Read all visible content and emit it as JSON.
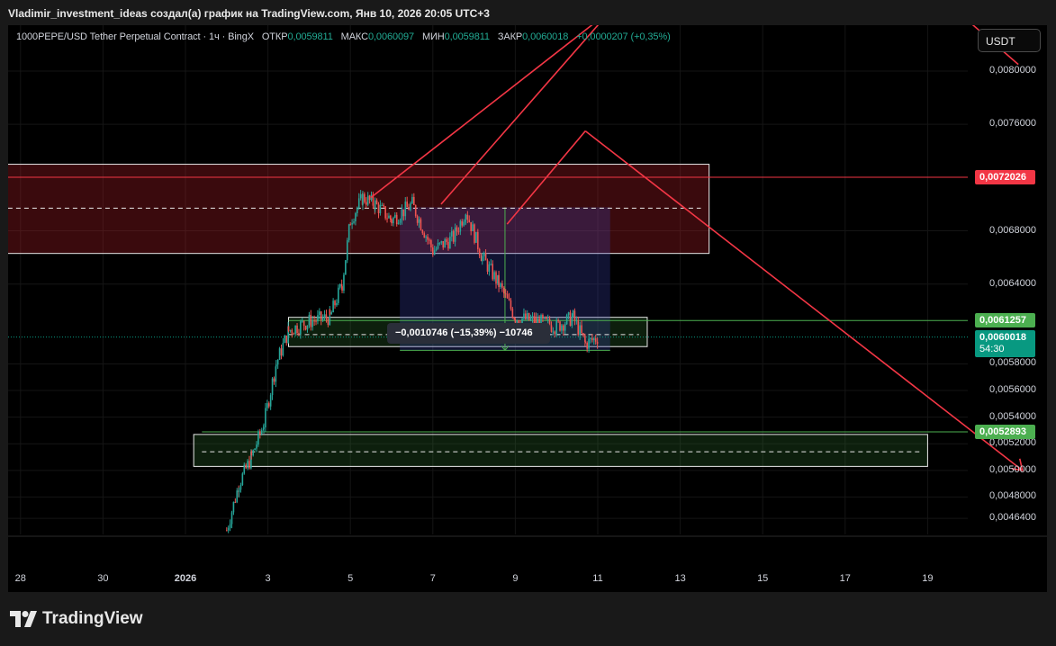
{
  "header": {
    "title": "Vladimir_investment_ideas создал(а) график на TradingView.com, Янв 10, 2026 20:05 UTC+3"
  },
  "legend": {
    "symbol": "1000PEPE/USD Tether Perpetual Contract · 1ч · BingX",
    "open_label": "ОТКР",
    "open_value": "0,0059811",
    "high_label": "МАКС",
    "high_value": "0,0060097",
    "low_label": "МИН",
    "low_value": "0,0059811",
    "close_label": "ЗАКР",
    "close_value": "0,0060018",
    "change": "+0,0000207 (+0,35%)"
  },
  "currency_button": "USDT",
  "price_axis": {
    "ticks": [
      {
        "label": "0,0080000",
        "value": 0.008
      },
      {
        "label": "0,0076000",
        "value": 0.0076
      },
      {
        "label": "0,0068000",
        "value": 0.0068
      },
      {
        "label": "0,0064000",
        "value": 0.0064
      },
      {
        "label": "0,0058000",
        "value": 0.0058
      },
      {
        "label": "0,0056000",
        "value": 0.0056
      },
      {
        "label": "0,0054000",
        "value": 0.0054
      },
      {
        "label": "0,0052000",
        "value": 0.0052
      },
      {
        "label": "0,0050000",
        "value": 0.005
      },
      {
        "label": "0,0048000",
        "value": 0.0048
      },
      {
        "label": "0,0046400",
        "value": 0.00464
      }
    ],
    "badges": {
      "resistance": {
        "label": "0,0072026",
        "value": 0.0072026,
        "color": "#f23645"
      },
      "mid_level": {
        "label": "0,0061257",
        "value": 0.0061257,
        "color": "#4caf50"
      },
      "last_price": {
        "label": "0,0060018",
        "value": 0.0060018,
        "timer": "54:30",
        "color": "#089981"
      },
      "support": {
        "label": "0,0052893",
        "value": 0.0052893,
        "color": "#4caf50"
      }
    }
  },
  "time_axis": {
    "ticks": [
      {
        "label": "28",
        "day": -4
      },
      {
        "label": "30",
        "day": -2
      },
      {
        "label": "2026",
        "day": 0
      },
      {
        "label": "3",
        "day": 2
      },
      {
        "label": "5",
        "day": 4
      },
      {
        "label": "7",
        "day": 6
      },
      {
        "label": "9",
        "day": 8
      },
      {
        "label": "11",
        "day": 10
      },
      {
        "label": "13",
        "day": 12
      },
      {
        "label": "15",
        "day": 14
      },
      {
        "label": "17",
        "day": 16
      },
      {
        "label": "19",
        "day": 18
      }
    ]
  },
  "measure": {
    "text": "−0,0010746 (−15,39%) −10746",
    "from_price": 0.0069765,
    "to_price": 0.0059019
  },
  "chart_data": {
    "type": "candlestick",
    "title": "1000PEPE/USD Tether Perpetual Contract · 1ч · BingX",
    "ylim": [
      0.0045,
      0.0082
    ],
    "xlim_days": [
      -4.5,
      20.3
    ],
    "day_origin": "2026-01-01",
    "candles_summary": [
      {
        "day": 1.0,
        "price": 0.00455
      },
      {
        "day": 1.3,
        "price": 0.0049
      },
      {
        "day": 1.6,
        "price": 0.0051
      },
      {
        "day": 1.9,
        "price": 0.00535
      },
      {
        "day": 2.2,
        "price": 0.0058
      },
      {
        "day": 2.5,
        "price": 0.00605
      },
      {
        "day": 3.0,
        "price": 0.00612
      },
      {
        "day": 3.5,
        "price": 0.00615
      },
      {
        "day": 3.8,
        "price": 0.0064
      },
      {
        "day": 4.0,
        "price": 0.00688
      },
      {
        "day": 4.3,
        "price": 0.00705
      },
      {
        "day": 4.6,
        "price": 0.007
      },
      {
        "day": 5.0,
        "price": 0.00688
      },
      {
        "day": 5.5,
        "price": 0.007
      },
      {
        "day": 6.0,
        "price": 0.00665
      },
      {
        "day": 6.5,
        "price": 0.00675
      },
      {
        "day": 6.8,
        "price": 0.00695
      },
      {
        "day": 7.2,
        "price": 0.0066
      },
      {
        "day": 7.6,
        "price": 0.0064
      },
      {
        "day": 8.0,
        "price": 0.00615
      },
      {
        "day": 8.5,
        "price": 0.00612
      },
      {
        "day": 9.0,
        "price": 0.00608
      },
      {
        "day": 9.4,
        "price": 0.00615
      },
      {
        "day": 9.7,
        "price": 0.00595
      },
      {
        "day": 10.0,
        "price": 0.006
      }
    ],
    "zones": [
      {
        "name": "resistance-zone",
        "day_from": -4.5,
        "day_to": 12.7,
        "price_from": 0.00663,
        "price_to": 0.0073,
        "color": "#f23645"
      },
      {
        "name": "mid-zone",
        "day_from": 2.5,
        "day_to": 11.2,
        "price_from": 0.00593,
        "price_to": 0.00615,
        "color": "#4caf50"
      },
      {
        "name": "support-zone",
        "day_from": 0.2,
        "day_to": 18.0,
        "price_from": 0.00503,
        "price_to": 0.00527,
        "color": "#4caf50"
      }
    ],
    "dashed_levels": [
      {
        "price": 0.00697,
        "day_from": -4.5,
        "day_to": 12.5
      },
      {
        "price": 0.00602,
        "day_from": 2.5,
        "day_to": 11.0
      },
      {
        "price": 0.00514,
        "day_from": 0.4,
        "day_to": 17.8
      }
    ],
    "horizontal_lines": [
      {
        "price": 0.0072026,
        "color": "#f23645"
      },
      {
        "price": 0.0061257,
        "color": "#4caf50"
      },
      {
        "price": 0.0052893,
        "color": "#4caf50"
      }
    ],
    "trend_lines": [
      {
        "from": [
          4.5,
          0.00705
        ],
        "to": [
          10.7,
          0.00855
        ],
        "color": "#f23645"
      },
      {
        "from": [
          6.2,
          0.007
        ],
        "to": [
          10.3,
          0.00845
        ],
        "color": "#f23645"
      },
      {
        "from": [
          7.8,
          0.00685
        ],
        "to": [
          9.7,
          0.00755
        ],
        "color": "#f23645"
      },
      {
        "from": [
          9.7,
          0.00755
        ],
        "to": [
          20.3,
          0.005
        ],
        "color": "#f23645"
      },
      {
        "from": [
          17.6,
          0.00875
        ],
        "to": [
          20.2,
          0.00805
        ],
        "color": "#f23645"
      }
    ],
    "measure_box": {
      "day_from": 5.2,
      "day_to": 10.3,
      "price_from": 0.0059019,
      "price_to": 0.0069765
    }
  }
}
